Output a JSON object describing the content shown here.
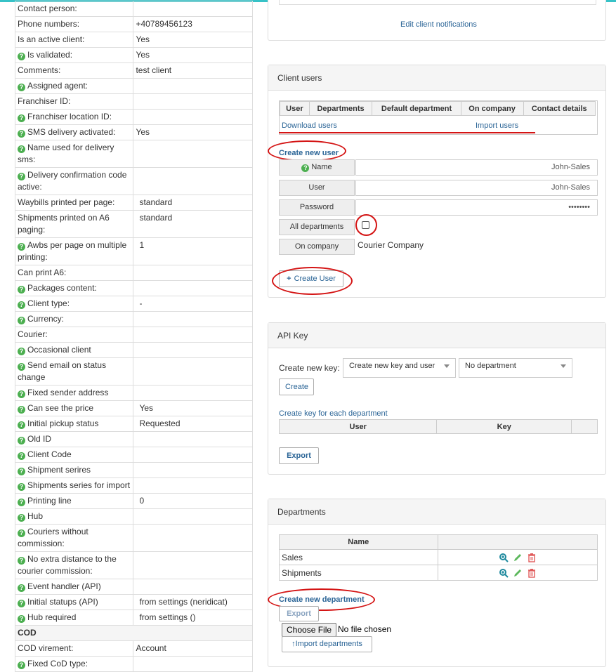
{
  "client_details": {
    "rows": [
      {
        "label": "Contact person:",
        "value": "",
        "help": false
      },
      {
        "label": "Phone numbers:",
        "value": "+40789456123",
        "help": false
      },
      {
        "label": "Is an active client:",
        "value": "Yes",
        "help": false
      },
      {
        "label": "Is validated:",
        "value": "Yes",
        "help": true
      },
      {
        "label": "Comments:",
        "value": "test client",
        "help": false
      },
      {
        "label": "Assigned agent:",
        "value": "",
        "help": true
      },
      {
        "label": "Franchiser ID:",
        "value": "",
        "help": false
      },
      {
        "label": "Franchiser location ID:",
        "value": "",
        "help": true
      },
      {
        "label": "SMS delivery activated:",
        "value": "Yes",
        "help": true
      },
      {
        "label": "Name used for delivery sms:",
        "value": "",
        "help": true
      },
      {
        "label": "Delivery confirmation code active:",
        "value": "",
        "help": true
      },
      {
        "label": "Waybills printed per page:",
        "value": "standard",
        "help": false
      },
      {
        "label": "Shipments printed on A6 paging:",
        "value": "standard",
        "help": false
      },
      {
        "label": "Awbs per page on multiple printing:",
        "value": "1",
        "help": true
      },
      {
        "label": "Can print A6:",
        "value": "",
        "help": false
      },
      {
        "label": "Packages content:",
        "value": "",
        "help": true
      },
      {
        "label": "Client type:",
        "value": "-",
        "help": true
      },
      {
        "label": "Currency:",
        "value": "",
        "help": true
      },
      {
        "label": "Courier:",
        "value": "",
        "help": false
      },
      {
        "label": "Occasional client",
        "value": "",
        "help": true
      },
      {
        "label": "Send email on status change",
        "value": "",
        "help": true
      },
      {
        "label": "Fixed sender address",
        "value": "",
        "help": true
      },
      {
        "label": "Can see the price",
        "value": "Yes",
        "help": true
      },
      {
        "label": "Initial pickup status",
        "value": "Requested",
        "help": true
      },
      {
        "label": "Old ID",
        "value": "",
        "help": true
      },
      {
        "label": "Client Code",
        "value": "",
        "help": true
      },
      {
        "label": "Shipment serires",
        "value": "",
        "help": true
      },
      {
        "label": "Shipments series for import",
        "value": "",
        "help": true
      },
      {
        "label": "Printing line",
        "value": "0",
        "help": true
      },
      {
        "label": "Hub",
        "value": "",
        "help": true
      },
      {
        "label": "Couriers without commission:",
        "value": "",
        "help": true
      },
      {
        "label": "No extra distance to the courier commission:",
        "value": "",
        "help": true
      },
      {
        "label": "Event handler (API)",
        "value": "",
        "help": true
      },
      {
        "label": "Initial statups (API)",
        "value": "from settings (neridicat)",
        "help": true
      },
      {
        "label": "Hub required",
        "value": "from settings ()",
        "help": true
      }
    ],
    "cod_section_title": "COD",
    "cod_rows": [
      {
        "label": "COD virement:",
        "value": "Account",
        "help": false
      },
      {
        "label": "Fixed CoD type:",
        "value": "",
        "help": true
      }
    ]
  },
  "notifications": {
    "edit_link": "Edit client notifications"
  },
  "client_users": {
    "title": "Client users",
    "columns": [
      "User",
      "Departments",
      "Default department",
      "On company",
      "Contact details"
    ],
    "download_link": "Download users",
    "import_link": "Import users",
    "create_new_user_link": "Create new user",
    "form": {
      "name_label": "Name",
      "name_value": "John-Sales",
      "user_label": "User",
      "user_value": "John-Sales",
      "password_label": "Password",
      "password_value": "••••••••",
      "all_departments_label": "All departments",
      "on_company_label": "On company",
      "on_company_value": "Courier Company"
    },
    "create_user_button": "Create User"
  },
  "api_key": {
    "title": "API Key",
    "create_new_key_label": "Create new key:",
    "key_type_selected": "Create new key and user",
    "department_selected": "No department",
    "create_button": "Create",
    "create_each_dept_link": "Create key for each department",
    "columns": [
      "User",
      "Key"
    ],
    "export_button": "Export"
  },
  "departments": {
    "title": "Departments",
    "column_name": "Name",
    "rows": [
      {
        "name": "Sales"
      },
      {
        "name": "Shipments"
      }
    ],
    "create_new_department_link": "Create new department",
    "export_button": "Export",
    "choose_file_button": "Choose File",
    "no_file_text": "No file chosen",
    "import_button": "Import departments"
  },
  "colors": {
    "accent_teal": "#37c2c7",
    "link_blue": "#2a6496",
    "help_green": "#4caf50",
    "highlight_red": "#d41414"
  }
}
